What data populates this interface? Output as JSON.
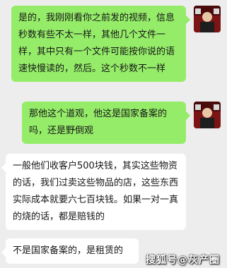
{
  "messages": [
    {
      "side": "outgoing",
      "text": "是的，我刚刚看你之前发的视频，信息秒数有些不太一样，其他几个文件一样，其中只有一个文件可能按你说的语速快慢读的，然后。这个秒数不一样"
    },
    {
      "side": "outgoing",
      "text": "那他这个道观，他这是国家备案的吗，还是野倒观"
    },
    {
      "side": "incoming",
      "text": "一般他们收客户500块钱，其实这些物资的话，我们过卖这些物品的店，这些东西实际成本就要六七百块钱。如果一对一真的烧的话，都是赔钱的"
    },
    {
      "side": "incoming",
      "text": "不是国家备案的，是租赁的"
    }
  ],
  "watermark": "搜狐号@灰产圈",
  "colors": {
    "background": "#ededed",
    "outgoing_bubble": "#95ec69",
    "incoming_bubble": "#ffffff"
  }
}
